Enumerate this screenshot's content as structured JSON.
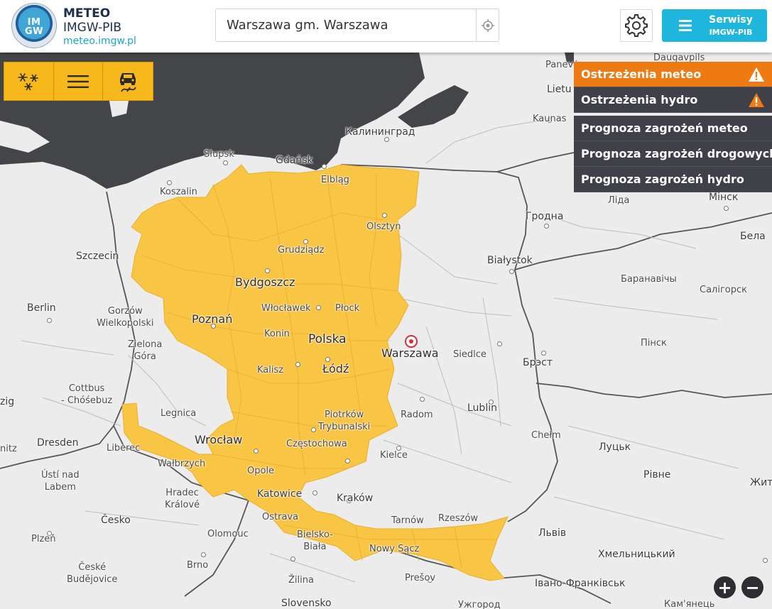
{
  "header": {
    "brand_title": "METEO",
    "brand_subtitle": "IMGW-PIB",
    "brand_url": "meteo.imgw.pl",
    "logo_text": "IM\nGW",
    "search_value": "Warszawa gm. Warszawa",
    "services_label": "Serwisy",
    "services_sub": "IMGW-PIB"
  },
  "tools": {
    "items": [
      "snowflakes-icon",
      "menu-lines-icon",
      "slippery-road-icon"
    ]
  },
  "menu": {
    "items": [
      {
        "label": "Ostrzeżenia meteo",
        "icon": "warning-icon"
      },
      {
        "label": "Ostrzeżenia hydro",
        "icon": "warning-icon"
      },
      {
        "label": "Prognoza zagrożeń meteo"
      },
      {
        "label": "Prognoza zagrożeń drogowych"
      },
      {
        "label": "Prognoza zagrożeń hydro"
      }
    ]
  },
  "map": {
    "warning_color": "#f9c545",
    "sea_color": "#444548",
    "land_color": "#ececec",
    "labels": {
      "daugavpils": "Daugavpils",
      "panev": "Panevė",
      "lietu": "Lietu",
      "kaunas": "Kaunas",
      "kaliningrad": "Калининград",
      "slupsk": "Słupsk",
      "gdansk": "Gdańsk",
      "elblag": "Elbląg",
      "koszalin": "Koszalin",
      "olsztyn": "Olsztyn",
      "szczecin": "Szczecin",
      "grudziadz": "Grudziądz",
      "bydgoszcz": "Bydgoszcz",
      "berlin": "Berlin",
      "gorzow": "Gorzów\nWielkopolski",
      "poznan": "Poznań",
      "wloclawek": "Włocławek",
      "plock": "Płock",
      "konin": "Konin",
      "polska": "Polska",
      "warszawa": "Warszawa",
      "siedlce": "Siedlce",
      "zielona": "Zielona\nGóra",
      "kalisz": "Kalisz",
      "lodz": "Łódź",
      "cottbus": "Cottbus\n- Chóśebuz",
      "zig": "zig",
      "legnica": "Legnica",
      "piotrkow": "Piotrków\nTrybunalski",
      "radom": "Radom",
      "lublin": "Lublin",
      "chelm": "Chełm",
      "dresden": "Dresden",
      "liberec": "Liberec",
      "wroclaw": "Wrocław",
      "czestochowa": "Częstochowa",
      "kielce": "Kielce",
      "nitz": "nitz",
      "walbrzych": "Wałbrzych",
      "usti": "Ústí nad\nLabem",
      "opole": "Opole",
      "hradec": "Hradec\nKrálové",
      "katowice": "Katowice",
      "krakow": "Kraków",
      "cesko": "Česko",
      "ostrava": "Ostrava",
      "tarnow": "Tarnów",
      "rzeszow": "Rzeszów",
      "plzen": "Plzeň",
      "olomouc": "Olomouc",
      "bielsko": "Bielsko-\nBiała",
      "nowysacz": "Nowy Sącz",
      "brno": "Brno",
      "ceske": "České\nBudějovice",
      "zilina": "Žilina",
      "presov": "Prešov",
      "slovensko": "Slovensko",
      "bialystok": "Białystok",
      "grodno": "Гродна",
      "lida": "Ліда",
      "minsk": "Мінск",
      "bela": "Бела",
      "baranavichy": "Баранавічы",
      "salihorsk": "Салігорск",
      "pinsk": "Пінск",
      "brest": "Брэст",
      "lutsk": "Луцьк",
      "rivne": "Рівне",
      "zhy": "Жит",
      "lviv": "Львів",
      "khmelnytskyi": "Хмельницький",
      "ivano": "Івано-Франківськ",
      "uzhhorod": "Ужгород",
      "kamianets": "Кам'янець"
    }
  },
  "zoom": {
    "in": "+",
    "out": "−"
  }
}
